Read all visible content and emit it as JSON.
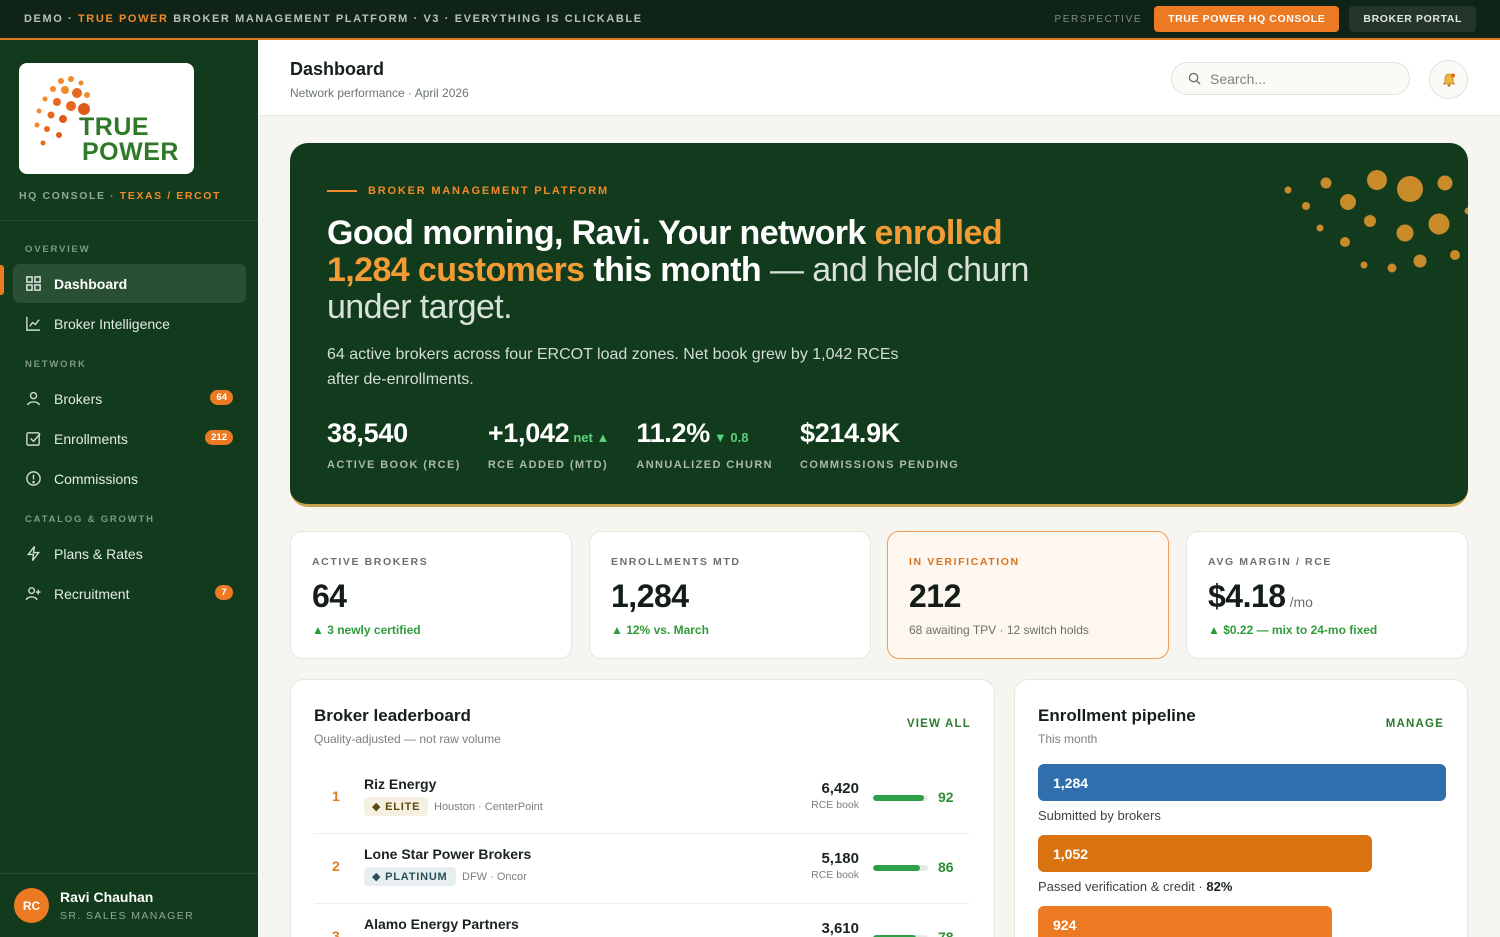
{
  "demo_bar": {
    "prefix": "DEMO · ",
    "brand": "TRUE POWER",
    "suffix": " BROKER MANAGEMENT PLATFORM · V3 · EVERYTHING IS CLICKABLE",
    "perspective_label": "PERSPECTIVE",
    "hq_button": "TRUE POWER HQ CONSOLE",
    "portal_button": "BROKER PORTAL"
  },
  "colors": {
    "brand_green": "#123a1c",
    "accent_orange": "#ec7a22",
    "positive": "#2f9b3a",
    "pipeline_blue": "#2f6fae"
  },
  "sidebar": {
    "logo": {
      "line1": "TRUE",
      "line2": "POWER"
    },
    "console_label": "HQ CONSOLE · ",
    "region": "TEXAS / ERCOT",
    "sections": {
      "overview": "OVERVIEW",
      "network": "NETWORK",
      "catalog": "CATALOG & GROWTH"
    },
    "items": [
      {
        "label": "Dashboard",
        "icon": "grid-icon",
        "active": true
      },
      {
        "label": "Broker Intelligence",
        "icon": "line-chart-icon"
      },
      {
        "label": "Brokers",
        "icon": "person-icon",
        "badge": "64"
      },
      {
        "label": "Enrollments",
        "icon": "checkbox-icon",
        "badge": "212"
      },
      {
        "label": "Commissions",
        "icon": "info-circle-icon"
      },
      {
        "label": "Plans & Rates",
        "icon": "bolt-icon"
      },
      {
        "label": "Recruitment",
        "icon": "person-plus-icon",
        "badge": "7"
      }
    ],
    "user": {
      "initials": "RC",
      "name": "Ravi Chauhan",
      "role": "SR. SALES MANAGER"
    }
  },
  "header": {
    "title": "Dashboard",
    "subtitle": "Network performance · April 2026",
    "search_placeholder": "Search...",
    "bell_icon": "bell-icon"
  },
  "hero": {
    "kicker": "BROKER MANAGEMENT PLATFORM",
    "headline_1": "Good morning, Ravi. Your network ",
    "headline_hl1": "enrolled 1,284 customers",
    "headline_2": " this month",
    "headline_light": " — and held churn under target.",
    "description": "64 active brokers across four ERCOT load zones. Net book grew by 1,042 RCEs after de-enrollments.",
    "stats": [
      {
        "value": "38,540",
        "suffix": "",
        "label": "ACTIVE BOOK (RCE)"
      },
      {
        "value": "+1,042",
        "suffix": "net ▲",
        "label": "RCE ADDED (MTD)"
      },
      {
        "value": "11.2%",
        "suffix": "▼ 0.8",
        "label": "ANNUALIZED CHURN"
      },
      {
        "value": "$214.9K",
        "suffix": "",
        "label": "COMMISSIONS PENDING"
      }
    ]
  },
  "kpis": [
    {
      "label": "ACTIVE BROKERS",
      "value": "64",
      "unit": "",
      "foot": "▲ 3 newly certified"
    },
    {
      "label": "ENROLLMENTS MTD",
      "value": "1,284",
      "unit": "",
      "foot": "▲ 12% vs. March"
    },
    {
      "label": "IN VERIFICATION",
      "value": "212",
      "unit": "",
      "foot": "68 awaiting TPV · 12 switch holds"
    },
    {
      "label": "AVG MARGIN / RCE",
      "value": "$4.18",
      "unit": "/mo",
      "foot": "▲ $0.22 — mix to 24-mo fixed"
    }
  ],
  "leaderboard": {
    "title": "Broker leaderboard",
    "subtitle": "Quality-adjusted — not raw volume",
    "link": "VIEW ALL",
    "book_label": "RCE book",
    "rows": [
      {
        "rank": "1",
        "name": "Riz Energy",
        "tier": "◆ ELITE",
        "location": "Houston · CenterPoint",
        "book": "6,420",
        "score": "92"
      },
      {
        "rank": "2",
        "name": "Lone Star Power Brokers",
        "tier": "◆ PLATINUM",
        "location": "DFW · Oncor",
        "book": "5,180",
        "score": "86"
      },
      {
        "rank": "3",
        "name": "Alamo Energy Partners",
        "tier": "",
        "location": "",
        "book": "3,610",
        "score": "78"
      }
    ]
  },
  "pipeline": {
    "title": "Enrollment pipeline",
    "subtitle": "This month",
    "link": "MANAGE",
    "stages": [
      {
        "value": "1,284",
        "label": "Submitted by brokers",
        "pct": ""
      },
      {
        "value": "1,052",
        "label": "Passed verification & credit · ",
        "pct": "82%"
      },
      {
        "value": "924",
        "label": "",
        "pct": ""
      }
    ]
  }
}
